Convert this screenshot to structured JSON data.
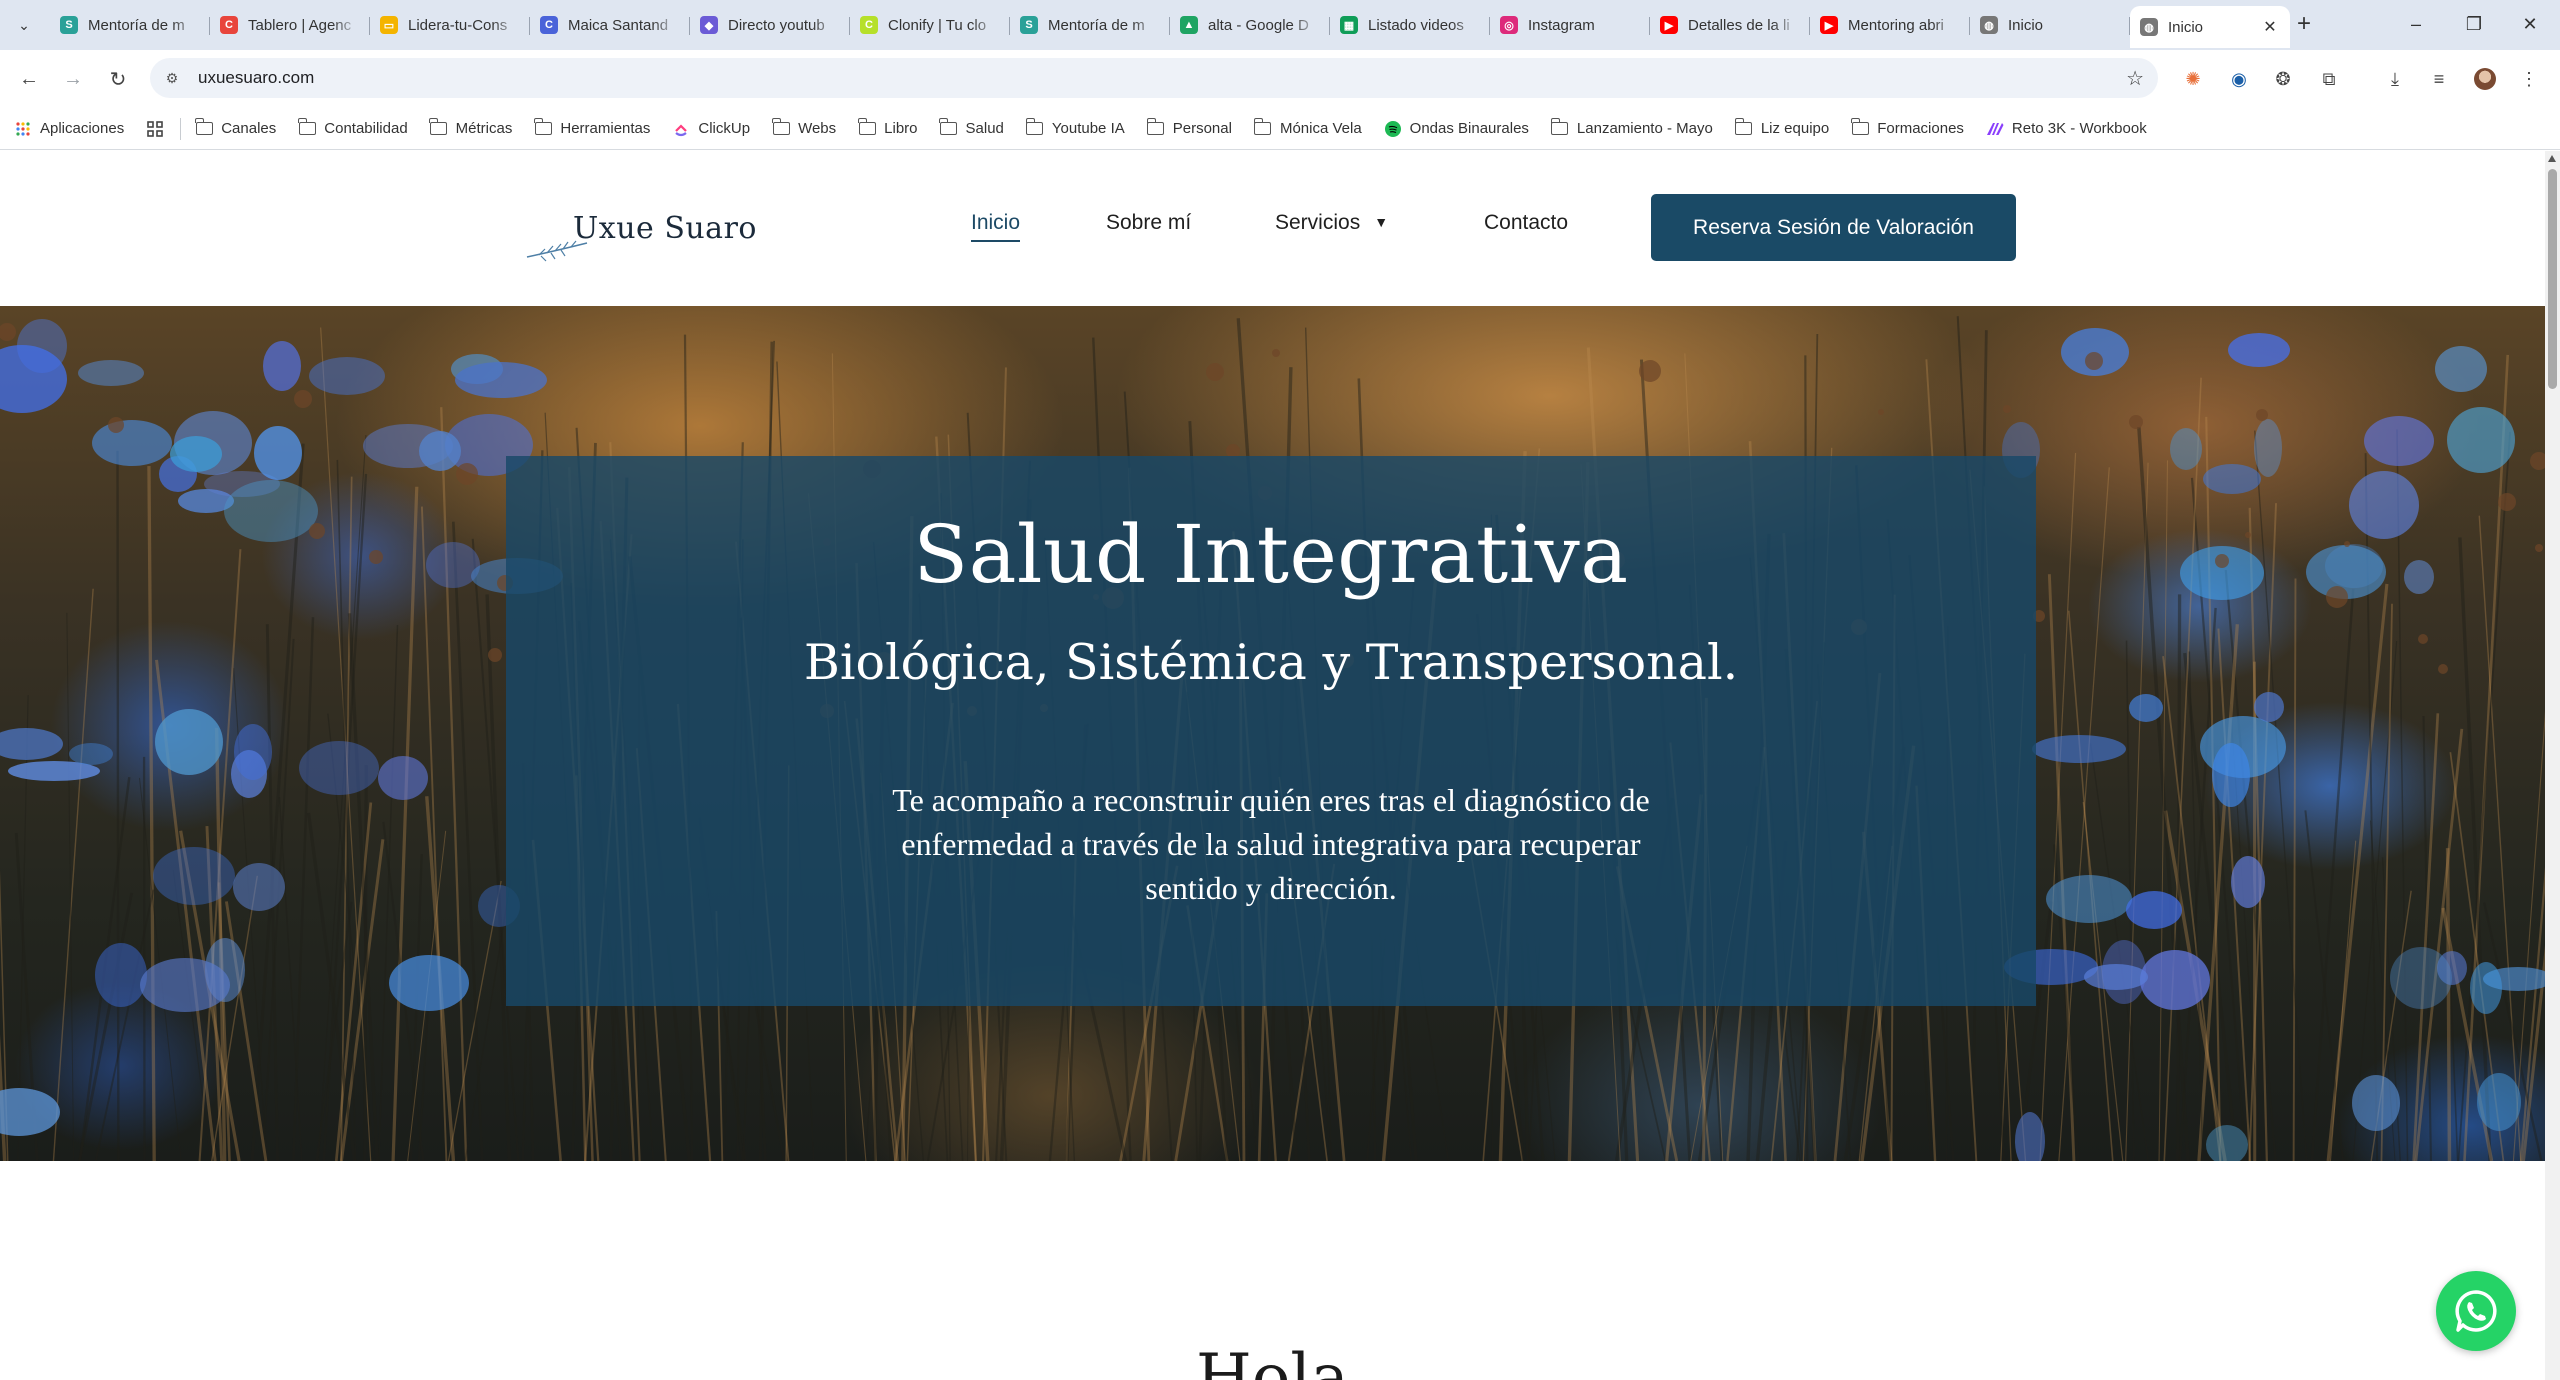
{
  "browser": {
    "tabs": [
      {
        "title": "Mentoría de m",
        "favicon": "s-logo",
        "color": "#2aa198",
        "glyph": "S"
      },
      {
        "title": "Tablero | Agenc",
        "favicon": "c-logo",
        "color": "#e8453c",
        "glyph": "C"
      },
      {
        "title": "Lidera-tu-Cons",
        "favicon": "slides-icon",
        "color": "#f4b400",
        "glyph": "▭"
      },
      {
        "title": "Maica Santand",
        "favicon": "c-circle-logo",
        "color": "#4a63d9",
        "glyph": "C"
      },
      {
        "title": "Directo youtub",
        "favicon": "chat-logo",
        "color": "#6b5bd6",
        "glyph": "◆"
      },
      {
        "title": "Clonify | Tu clo",
        "favicon": "clonify-logo",
        "color": "#b6e02a",
        "glyph": "C"
      },
      {
        "title": "Mentoría de m",
        "favicon": "s-logo",
        "color": "#2aa198",
        "glyph": "S"
      },
      {
        "title": "alta - Google D",
        "favicon": "drive-icon",
        "color": "#1fa463",
        "glyph": "▲"
      },
      {
        "title": "Listado videos",
        "favicon": "sheets-icon",
        "color": "#0f9d58",
        "glyph": "▦"
      },
      {
        "title": "Instagram",
        "favicon": "instagram-icon",
        "color": "#dd2a7b",
        "glyph": "◎"
      },
      {
        "title": "Detalles de la li",
        "favicon": "youtube-icon",
        "color": "#ff0000",
        "glyph": "▶"
      },
      {
        "title": "Mentoring abri",
        "favicon": "youtube-icon",
        "color": "#ff0000",
        "glyph": "▶"
      },
      {
        "title": "Inicio",
        "favicon": "globe-icon",
        "color": "#777777",
        "glyph": "◍"
      },
      {
        "title": "Inicio",
        "favicon": "globe-icon",
        "color": "#777777",
        "glyph": "◍",
        "active": true
      }
    ],
    "url": "uxuesuaro.com",
    "bookmarks": [
      {
        "label": "Aplicaciones",
        "icon": "apps-grid-icon"
      },
      {
        "label": "",
        "icon": "grid-icon"
      },
      {
        "label": "Canales",
        "icon": "folder-icon"
      },
      {
        "label": "Contabilidad",
        "icon": "folder-icon"
      },
      {
        "label": "Métricas",
        "icon": "folder-icon"
      },
      {
        "label": "Herramientas",
        "icon": "folder-icon"
      },
      {
        "label": "ClickUp",
        "icon": "clickup-icon"
      },
      {
        "label": "Webs",
        "icon": "folder-icon"
      },
      {
        "label": "Libro",
        "icon": "folder-icon"
      },
      {
        "label": "Salud",
        "icon": "folder-icon"
      },
      {
        "label": "Youtube IA",
        "icon": "folder-icon"
      },
      {
        "label": "Personal",
        "icon": "folder-icon"
      },
      {
        "label": "Mónica Vela",
        "icon": "folder-icon"
      },
      {
        "label": "Ondas Binaurales",
        "icon": "spotify-icon"
      },
      {
        "label": "Lanzamiento - Mayo",
        "icon": "folder-icon"
      },
      {
        "label": "Liz equipo",
        "icon": "folder-icon"
      },
      {
        "label": "Formaciones",
        "icon": "folder-icon"
      },
      {
        "label": "Reto 3K - Workbook",
        "icon": "make-icon"
      }
    ]
  },
  "site": {
    "logo_text": "Uxue Suaro",
    "nav": {
      "inicio": "Inicio",
      "sobre": "Sobre mí",
      "servicios": "Servicios",
      "contacto": "Contacto"
    },
    "cta": "Reserva Sesión de Valoración",
    "hero": {
      "title": "Salud Integrativa",
      "subtitle": "Biológica, Sistémica y Transpersonal.",
      "text": "Te acompaño a reconstruir quién eres tras el diagnóstico de enfermedad a través de la salud integrativa para recuperar sentido y dirección."
    },
    "next_heading": "Hola"
  },
  "colors": {
    "brand": "#1a4a66",
    "hero_overlay": "#184868",
    "whatsapp": "#25d366"
  }
}
